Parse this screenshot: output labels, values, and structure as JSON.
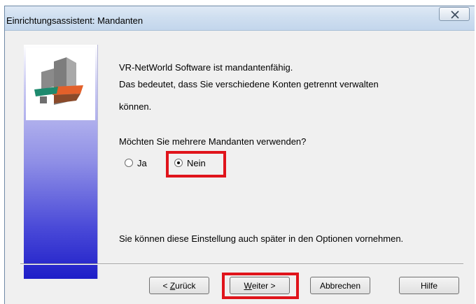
{
  "window": {
    "title": "Einrichtungsassistent: Mandanten",
    "close_icon": "close-icon"
  },
  "content": {
    "line1": "VR-NetWorld Software ist mandantenfähig.",
    "line2": "Das bedeutet, dass Sie verschiedene Konten getrennt verwalten",
    "line3": "können.",
    "question": "Möchten Sie mehrere Mandanten verwenden?",
    "options": [
      {
        "label": "Ja",
        "selected": false
      },
      {
        "label": "Nein",
        "selected": true
      }
    ],
    "footnote": "Sie können diese Einstellung auch später in den Optionen vornehmen."
  },
  "buttons": {
    "back": {
      "prefix": "< ",
      "mnemonic": "Z",
      "rest": "urück"
    },
    "next": {
      "mnemonic": "W",
      "rest": "eiter >"
    },
    "cancel": "Abbrechen",
    "help": "Hilfe"
  },
  "colors": {
    "highlight": "#e0141b",
    "banner_dark": "#1e1ec8"
  }
}
